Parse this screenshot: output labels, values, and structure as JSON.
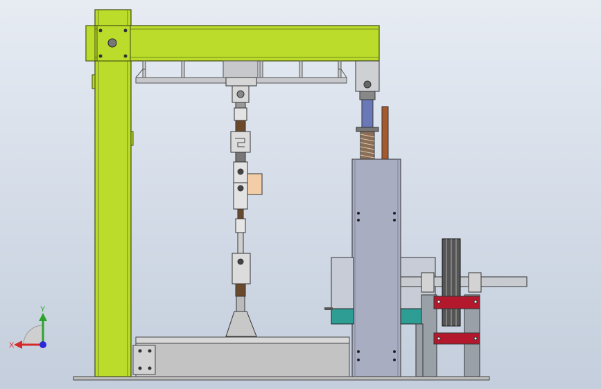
{
  "viewport": {
    "background": "#d7dee8"
  },
  "model": {
    "colors": {
      "frame": "#bbdc2a",
      "frame_edge": "#3f4a12",
      "steel": "#c9ccd3",
      "steel_dark": "#9aa0a8",
      "housing": "#a9adc2",
      "red_bracket": "#b3182c",
      "teal_support": "#2e9e95",
      "spring": "#8a6d55",
      "rod_blue": "#6b78b8",
      "orange_pad": "#f3cda7",
      "brown_rod": "#a55a2e",
      "base": "#c6c6c6"
    }
  },
  "triad": {
    "x_label": "X",
    "y_label": "Y",
    "x_color": "#d62a2a",
    "y_color": "#2aa52a",
    "z_color": "#2a2ad6"
  }
}
